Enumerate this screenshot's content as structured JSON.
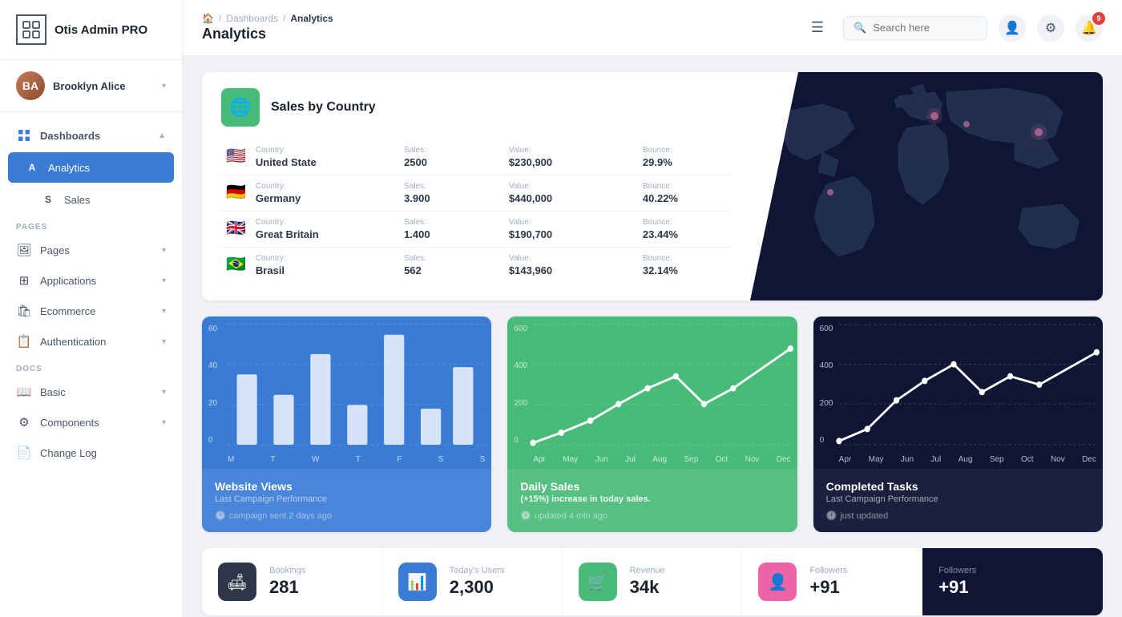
{
  "app": {
    "name": "Otis Admin PRO"
  },
  "user": {
    "name": "Brooklyn Alice",
    "initials": "BA"
  },
  "sidebar": {
    "sections": [
      {
        "items": [
          {
            "id": "dashboards",
            "label": "Dashboards",
            "icon": "⊞",
            "type": "parent",
            "expanded": true
          },
          {
            "id": "analytics",
            "label": "Analytics",
            "letter": "A",
            "active": true
          },
          {
            "id": "sales",
            "label": "Sales",
            "letter": "S"
          }
        ]
      },
      {
        "label": "PAGES",
        "items": [
          {
            "id": "pages",
            "label": "Pages",
            "icon": "🖼"
          },
          {
            "id": "applications",
            "label": "Applications",
            "icon": "⊞"
          },
          {
            "id": "ecommerce",
            "label": "Ecommerce",
            "icon": "🛍"
          },
          {
            "id": "authentication",
            "label": "Authentication",
            "icon": "📋"
          }
        ]
      },
      {
        "label": "DOCS",
        "items": [
          {
            "id": "basic",
            "label": "Basic",
            "icon": "📖"
          },
          {
            "id": "components",
            "label": "Components",
            "icon": "⚙"
          },
          {
            "id": "changelog",
            "label": "Change Log",
            "icon": "📄"
          }
        ]
      }
    ]
  },
  "header": {
    "breadcrumb": [
      "🏠",
      "Dashboards",
      "Analytics"
    ],
    "title": "Analytics",
    "search_placeholder": "Search here",
    "notification_count": "9"
  },
  "sales_by_country": {
    "title": "Sales by Country",
    "icon": "🌐",
    "rows": [
      {
        "flag": "🇺🇸",
        "country_label": "Country:",
        "country": "United State",
        "sales_label": "Sales:",
        "sales": "2500",
        "value_label": "Value:",
        "value": "$230,900",
        "bounce_label": "Bounce:",
        "bounce": "29.9%"
      },
      {
        "flag": "🇩🇪",
        "country_label": "Country:",
        "country": "Germany",
        "sales_label": "Sales:",
        "sales": "3.900",
        "value_label": "Value:",
        "value": "$440,000",
        "bounce_label": "Bounce:",
        "bounce": "40.22%"
      },
      {
        "flag": "🇬🇧",
        "country_label": "Country:",
        "country": "Great Britain",
        "sales_label": "Sales:",
        "sales": "1.400",
        "value_label": "Value:",
        "value": "$190,700",
        "bounce_label": "Bounce:",
        "bounce": "23.44%"
      },
      {
        "flag": "🇧🇷",
        "country_label": "Country:",
        "country": "Brasil",
        "sales_label": "Sales:",
        "sales": "562",
        "value_label": "Value:",
        "value": "$143,960",
        "bounce_label": "Bounce:",
        "bounce": "32.14%"
      }
    ]
  },
  "charts": {
    "website_views": {
      "title": "Website Views",
      "subtitle": "Last Campaign Performance",
      "time_label": "campaign sent 2 days ago",
      "y_labels": [
        "60",
        "40",
        "20",
        "0"
      ],
      "x_labels": [
        "M",
        "T",
        "W",
        "T",
        "F",
        "S",
        "S"
      ],
      "bars": [
        35,
        25,
        45,
        20,
        55,
        18,
        40
      ]
    },
    "daily_sales": {
      "title": "Daily Sales",
      "subtitle_prefix": "(+15%)",
      "subtitle_suffix": " increase in today sales.",
      "time_label": "updated 4 min ago",
      "y_labels": [
        "600",
        "400",
        "200",
        "0"
      ],
      "x_labels": [
        "Apr",
        "May",
        "Jun",
        "Jul",
        "Aug",
        "Sep",
        "Oct",
        "Nov",
        "Dec"
      ],
      "points": [
        10,
        60,
        120,
        200,
        280,
        340,
        200,
        280,
        480
      ]
    },
    "completed_tasks": {
      "title": "Completed Tasks",
      "subtitle": "Last Campaign Performance",
      "time_label": "just updated",
      "y_labels": [
        "600",
        "400",
        "200",
        "0"
      ],
      "x_labels": [
        "Apr",
        "May",
        "Jun",
        "Jul",
        "Aug",
        "Sep",
        "Oct",
        "Nov",
        "Dec"
      ],
      "points": [
        20,
        80,
        220,
        320,
        400,
        260,
        340,
        300,
        460
      ]
    }
  },
  "stats": [
    {
      "id": "bookings",
      "icon": "🛋",
      "icon_style": "dark",
      "label": "Bookings",
      "value": "281"
    },
    {
      "id": "today_users",
      "icon": "📊",
      "icon_style": "blue",
      "label": "Today's Users",
      "value": "2,300"
    },
    {
      "id": "revenue",
      "icon": "🛒",
      "icon_style": "green",
      "label": "Revenue",
      "value": "34k"
    },
    {
      "id": "followers",
      "icon": "👤",
      "icon_style": "pink",
      "label": "Followers",
      "value": "+91"
    }
  ]
}
